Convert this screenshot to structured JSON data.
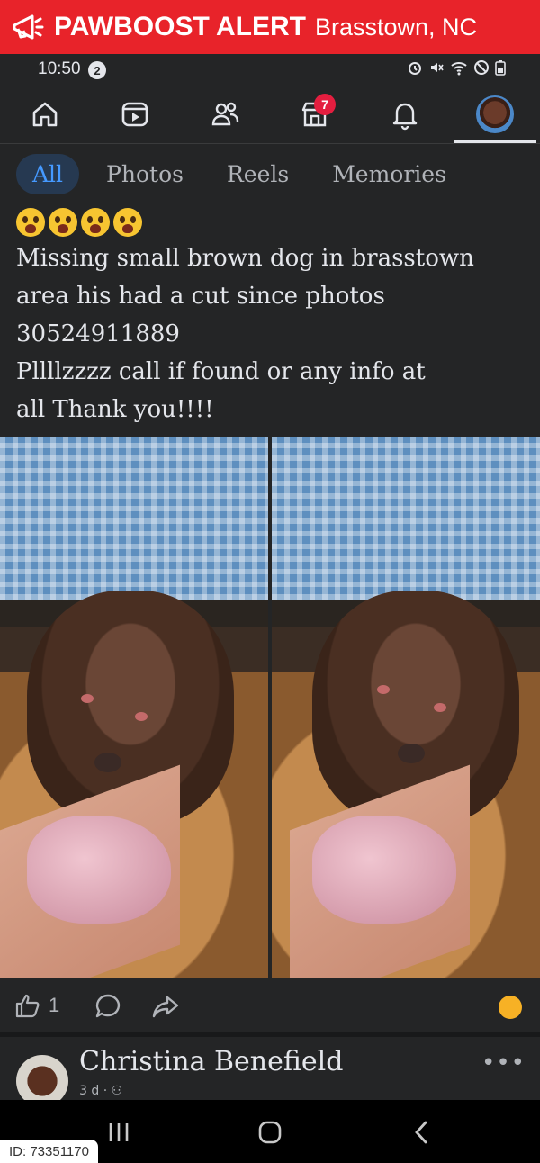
{
  "alert": {
    "title": "PAWBOOST ALERT",
    "location": "Brasstown, NC",
    "icon": "megaphone-icon"
  },
  "status_bar": {
    "time": "10:50",
    "notification_count": "2",
    "icons": [
      "alarm-icon",
      "mute-icon",
      "wifi-icon",
      "block-icon",
      "battery-icon"
    ]
  },
  "nav": {
    "items": [
      {
        "name": "home",
        "icon": "home-icon"
      },
      {
        "name": "reels",
        "icon": "video-icon"
      },
      {
        "name": "friends",
        "icon": "friends-icon"
      },
      {
        "name": "marketplace",
        "icon": "marketplace-icon",
        "badge": "7"
      },
      {
        "name": "notifications",
        "icon": "bell-icon"
      },
      {
        "name": "profile",
        "icon": "avatar"
      }
    ],
    "active": "profile"
  },
  "tabs": [
    {
      "label": "All",
      "active": true
    },
    {
      "label": "Photos",
      "active": false
    },
    {
      "label": "Reels",
      "active": false
    },
    {
      "label": "Memories",
      "active": false
    }
  ],
  "post": {
    "emojis": [
      "crying-face",
      "crying-face",
      "crying-face",
      "crying-face"
    ],
    "lines": [
      "Missing small brown dog in brasstown",
      "area his had a cut since photos",
      "30524911889",
      "Pllllzzzz call if found or any info at",
      "all Thank you!!!!"
    ]
  },
  "actions": {
    "like_count": "1",
    "reaction_emoji": "face-emoji"
  },
  "comment": {
    "author": "Christina Benefield",
    "meta": "3 d · ⚇",
    "more": "•••"
  },
  "image_id": "ID: 73351170",
  "colors": {
    "alert_red": "#e8232a",
    "background": "#242526",
    "text": "#e4e6eb",
    "muted": "#b0b3b8",
    "accent": "#4599ff",
    "badge": "#e41e3f"
  }
}
